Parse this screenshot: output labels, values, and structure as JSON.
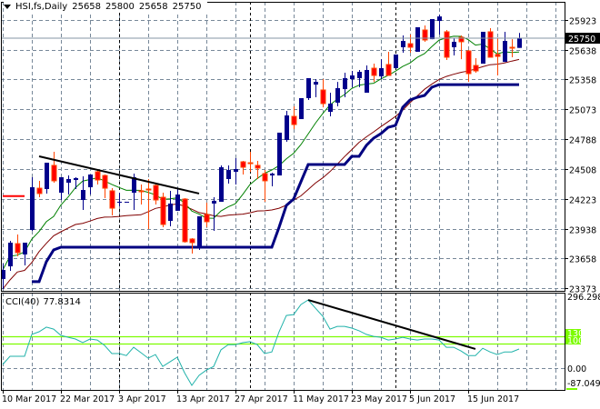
{
  "header": {
    "symbol": "HSI,fs,Daily",
    "open": "25658",
    "high": "25800",
    "low": "25658",
    "close": "25750",
    "icon": "triangle-down-icon"
  },
  "colors": {
    "bull_candle": "#00008B",
    "bear_candle": "#FF0000",
    "bear_wick": "#FF4500",
    "ma_fast": "#008000",
    "ma_slow": "#800000",
    "stop_line": "#000080",
    "cci_line": "#20B2AA",
    "cci_levels": "#7CFC00",
    "grid": "#778899",
    "trendline": "#000000"
  },
  "chart_data": [
    {
      "type": "candlestick",
      "grid": true,
      "ylim": [
        23348,
        26096
      ],
      "y_ticks": [
        "25923",
        "25638",
        "25358",
        "25073",
        "24788",
        "24508",
        "24223",
        "23938",
        "23658",
        "23373"
      ],
      "current_price": "25750",
      "x_ticks": [
        {
          "bar": 0,
          "label": "10 Mar 2017"
        },
        {
          "bar": 8,
          "label": "22 Mar 2017"
        },
        {
          "bar": 16,
          "label": "3 Apr 2017"
        },
        {
          "bar": 24,
          "label": "13 Apr 2017"
        },
        {
          "bar": 32,
          "label": "27 Apr 2017"
        },
        {
          "bar": 40,
          "label": "11 May 2017"
        },
        {
          "bar": 48,
          "label": "23 May 2017"
        },
        {
          "bar": 56,
          "label": "5 Jun 2017"
        },
        {
          "bar": 64,
          "label": "15 Jun 2017"
        }
      ],
      "month_separators": [
        16,
        34,
        54
      ],
      "bars_ohlc": [
        [
          23461,
          23607,
          23365,
          23547
        ],
        [
          23581,
          23823,
          23538,
          23806
        ],
        [
          23797,
          23884,
          23677,
          23711
        ],
        [
          23694,
          23806,
          23590,
          23806
        ],
        [
          23927,
          24428,
          23918,
          24333
        ],
        [
          24324,
          24394,
          24238,
          24273
        ],
        [
          24316,
          24566,
          24273,
          24566
        ],
        [
          24541,
          24670,
          24376,
          24394
        ],
        [
          24281,
          24428,
          24212,
          24428
        ],
        [
          24376,
          24445,
          24264,
          24411
        ],
        [
          24402,
          24428,
          24316,
          24420
        ],
        [
          24212,
          24437,
          24117,
          24307
        ],
        [
          24333,
          24454,
          24264,
          24454
        ],
        [
          24480,
          24506,
          24359,
          24402
        ],
        [
          24445,
          24454,
          24229,
          24324
        ],
        [
          24299,
          24324,
          24065,
          24134
        ],
        [
          24186,
          24281,
          24152,
          24195
        ],
        [
          24195,
          24195,
          24195,
          24195
        ],
        [
          24281,
          24463,
          24117,
          24428
        ],
        [
          24299,
          24359,
          24169,
          24290
        ],
        [
          24316,
          24411,
          23936,
          24307
        ],
        [
          24350,
          24368,
          24169,
          24212
        ],
        [
          24238,
          24281,
          23953,
          23979
        ],
        [
          24013,
          24299,
          23962,
          24178
        ],
        [
          24109,
          24316,
          24109,
          24264
        ],
        [
          24221,
          24229,
          23806,
          23815
        ],
        [
          23841,
          23849,
          23702,
          23806
        ],
        [
          23763,
          24057,
          23737,
          24057
        ],
        [
          24074,
          24186,
          23953,
          24005
        ],
        [
          24178,
          24238,
          23918,
          24204
        ],
        [
          24195,
          24541,
          24195,
          24523
        ],
        [
          24411,
          24541,
          24368,
          24497
        ],
        [
          24480,
          24610,
          24359,
          24506
        ],
        [
          24575,
          24584,
          24454,
          24523
        ],
        [
          24566,
          24670,
          24480,
          24558
        ],
        [
          24541,
          24584,
          24411,
          24515
        ],
        [
          24463,
          24497,
          24195,
          24394
        ],
        [
          24445,
          24471,
          24342,
          24463
        ],
        [
          24445,
          24852,
          24445,
          24852
        ],
        [
          24782,
          25059,
          24765,
          25016
        ],
        [
          25007,
          25102,
          24886,
          24929
        ],
        [
          24981,
          25180,
          24981,
          25180
        ],
        [
          25180,
          25370,
          25163,
          25370
        ],
        [
          25309,
          25361,
          25189,
          25335
        ],
        [
          25258,
          25361,
          25093,
          25128
        ],
        [
          25050,
          25232,
          25007,
          25128
        ],
        [
          25137,
          25335,
          25102,
          25275
        ],
        [
          25266,
          25422,
          25189,
          25370
        ],
        [
          25361,
          25439,
          25284,
          25396
        ],
        [
          25370,
          25448,
          25284,
          25430
        ],
        [
          25232,
          25491,
          25232,
          25448
        ],
        [
          25465,
          25508,
          25335,
          25396
        ],
        [
          25387,
          25551,
          25361,
          25465
        ],
        [
          25500,
          25621,
          25396,
          25396
        ],
        [
          25465,
          25595,
          25465,
          25595
        ],
        [
          25664,
          25776,
          25612,
          25724
        ],
        [
          25698,
          25785,
          25612,
          25664
        ],
        [
          25621,
          25854,
          25621,
          25854
        ],
        [
          25828,
          25871,
          25716,
          25733
        ],
        [
          25741,
          25932,
          25741,
          25932
        ],
        [
          25914,
          25975,
          25785,
          25957
        ],
        [
          25811,
          25828,
          25543,
          25569
        ],
        [
          25664,
          25750,
          25586,
          25716
        ],
        [
          25759,
          25776,
          25551,
          25716
        ],
        [
          25629,
          25638,
          25335,
          25413
        ],
        [
          25491,
          25560,
          25422,
          25439
        ],
        [
          25508,
          25811,
          25508,
          25811
        ],
        [
          25811,
          25845,
          25569,
          25569
        ],
        [
          25595,
          25750,
          25396,
          25577
        ],
        [
          25525,
          25811,
          25525,
          25724
        ],
        [
          25664,
          25741,
          25569,
          25660
        ],
        [
          25658,
          25800,
          25658,
          25750
        ]
      ],
      "stop_line": [
        null,
        null,
        null,
        null,
        23435,
        23435,
        23625,
        23737,
        23763,
        23763,
        23763,
        23763,
        23763,
        23763,
        23763,
        23763,
        23763,
        23763,
        23763,
        23763,
        23763,
        23763,
        23763,
        23763,
        23763,
        23763,
        23763,
        23763,
        23763,
        23763,
        23763,
        23763,
        23763,
        23763,
        23763,
        23763,
        23763,
        23763,
        23953,
        24160,
        24221,
        24385,
        24549,
        24549,
        24549,
        24549,
        24549,
        24549,
        24627,
        24627,
        24731,
        24800,
        24843,
        24903,
        24921,
        25093,
        25163,
        25189,
        25206,
        25284,
        25309,
        25309,
        25309,
        25309,
        25309,
        25309,
        25309,
        25309,
        25309,
        25309,
        25309,
        25309
      ],
      "level_segment": {
        "from_bar": 0,
        "to_bar": 3,
        "price": 24249
      },
      "trendline": {
        "from_bar": 5,
        "from_price": 24627,
        "to_bar": 27,
        "to_price": 24273
      }
    },
    {
      "type": "line",
      "name": "CCI(40)",
      "last_value": "77.8314",
      "grid": true,
      "ylim": [
        -87.0498,
        296.2986
      ],
      "y_labels": [
        "296.2986",
        "130",
        "100",
        "0.00",
        "-87.0498"
      ],
      "levels": [
        130,
        100
      ],
      "values": [
        14,
        48,
        48,
        48,
        138,
        149,
        168,
        160,
        134,
        126,
        119,
        104,
        119,
        115,
        93,
        59,
        59,
        51,
        85,
        63,
        40,
        55,
        6,
        25,
        44,
        -20,
        -72,
        -31,
        -9,
        6,
        74,
        96,
        96,
        104,
        108,
        96,
        59,
        66,
        149,
        216,
        220,
        261,
        280,
        246,
        213,
        160,
        171,
        171,
        164,
        153,
        138,
        130,
        126,
        115,
        119,
        126,
        119,
        115,
        119,
        119,
        115,
        85,
        85,
        70,
        51,
        51,
        81,
        66,
        55,
        66,
        66,
        78
      ],
      "trendline": {
        "from_bar": 42,
        "from_value": 280,
        "to_bar": 65,
        "to_value": 78
      }
    }
  ]
}
